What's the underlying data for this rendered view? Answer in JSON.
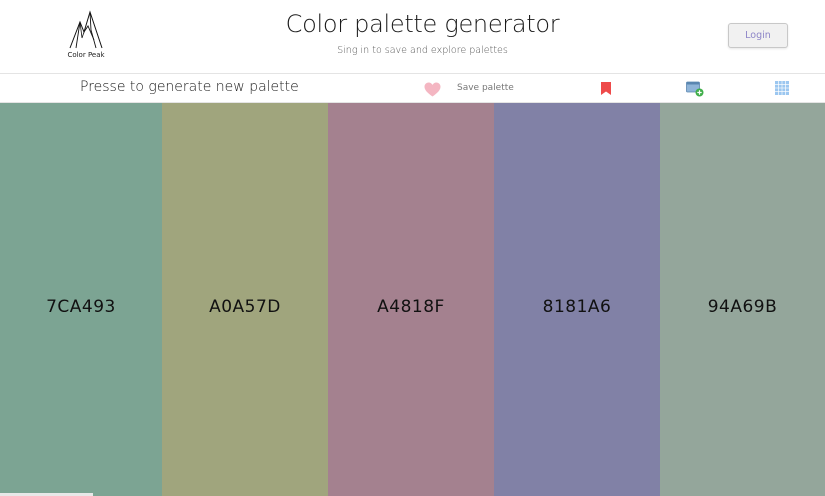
{
  "header": {
    "logo_text": "Color Peak",
    "title": "Color palette generator",
    "subtitle": "Sing in to save and explore palettes",
    "login_label": "Login"
  },
  "toolbar": {
    "hint": "Presse to generate new palette",
    "save_label": "Save palette",
    "icons": [
      "heart-icon",
      "bookmark-icon",
      "add-image-icon",
      "grid-icon"
    ],
    "heart_color": "#f4b6c2",
    "bookmark_color": "#ee4a4a",
    "grid_color": "#9cc7f0"
  },
  "palette": {
    "swatches": [
      {
        "code": "7CA493",
        "color": "#7ca493"
      },
      {
        "code": "A0A57D",
        "color": "#a0a57d"
      },
      {
        "code": "A4818F",
        "color": "#a4818f"
      },
      {
        "code": "8181A6",
        "color": "#8181a6"
      },
      {
        "code": "94A69B",
        "color": "#94a69b"
      }
    ]
  }
}
